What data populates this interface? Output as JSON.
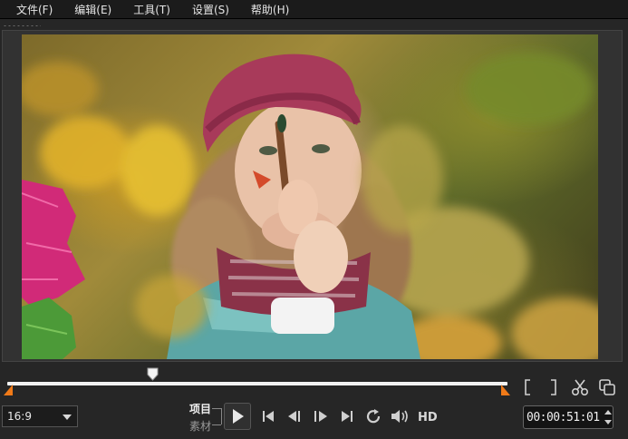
{
  "menu": {
    "file": "文件(F)",
    "edit": "编辑(E)",
    "tools": "工具(T)",
    "settings": "设置(S)",
    "help": "帮助(H)"
  },
  "player": {
    "aspect_ratio": "16:9",
    "mode_project": "项目",
    "mode_clip": "素材",
    "hd_label": "HD",
    "timecode": "00:00:51:01",
    "playhead_fraction": 0.29
  },
  "icons": {
    "mark_in": "bracket-left-icon",
    "mark_out": "bracket-right-icon",
    "split": "scissors-icon",
    "copy_frame": "overlap-squares-icon",
    "play": "play-icon",
    "start": "skip-start-icon",
    "prev_frame": "step-back-icon",
    "next_frame": "step-forward-icon",
    "end": "skip-end-icon",
    "repeat": "repeat-icon",
    "volume": "volume-icon"
  },
  "colors": {
    "accent_orange": "#f07a18",
    "scrub_track": "#f2f2f2",
    "background": "#262626"
  }
}
